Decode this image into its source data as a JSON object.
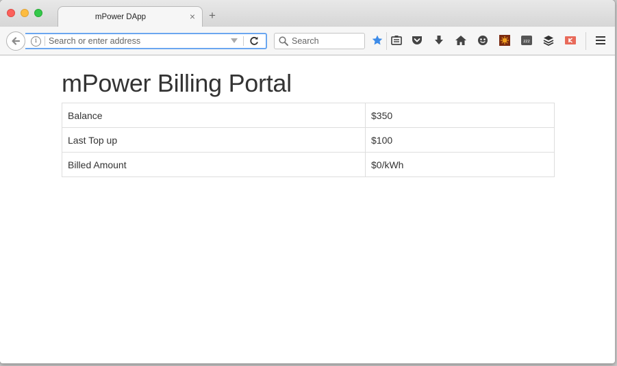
{
  "browser": {
    "tab_title": "mPower DApp",
    "tab_close_glyph": "×",
    "new_tab_glyph": "+",
    "url_placeholder": "Search or enter address",
    "url_value": "",
    "search_placeholder": "Search",
    "info_glyph": "i",
    "toolbar_icons": [
      "bookmark-star-icon",
      "reading-list-icon",
      "pocket-icon",
      "download-icon",
      "home-icon",
      "emoji-icon",
      "extension-sun-icon",
      "zzz-icon",
      "layers-icon",
      "k-extension-icon",
      "hamburger-menu-icon"
    ],
    "accent_color": "#6aa6f0"
  },
  "page": {
    "title": "mPower Billing Portal",
    "rows": [
      {
        "label": "Balance",
        "value": "$350"
      },
      {
        "label": "Last Top up",
        "value": "$100"
      },
      {
        "label": "Billed Amount",
        "value": "$0/kWh"
      }
    ]
  }
}
